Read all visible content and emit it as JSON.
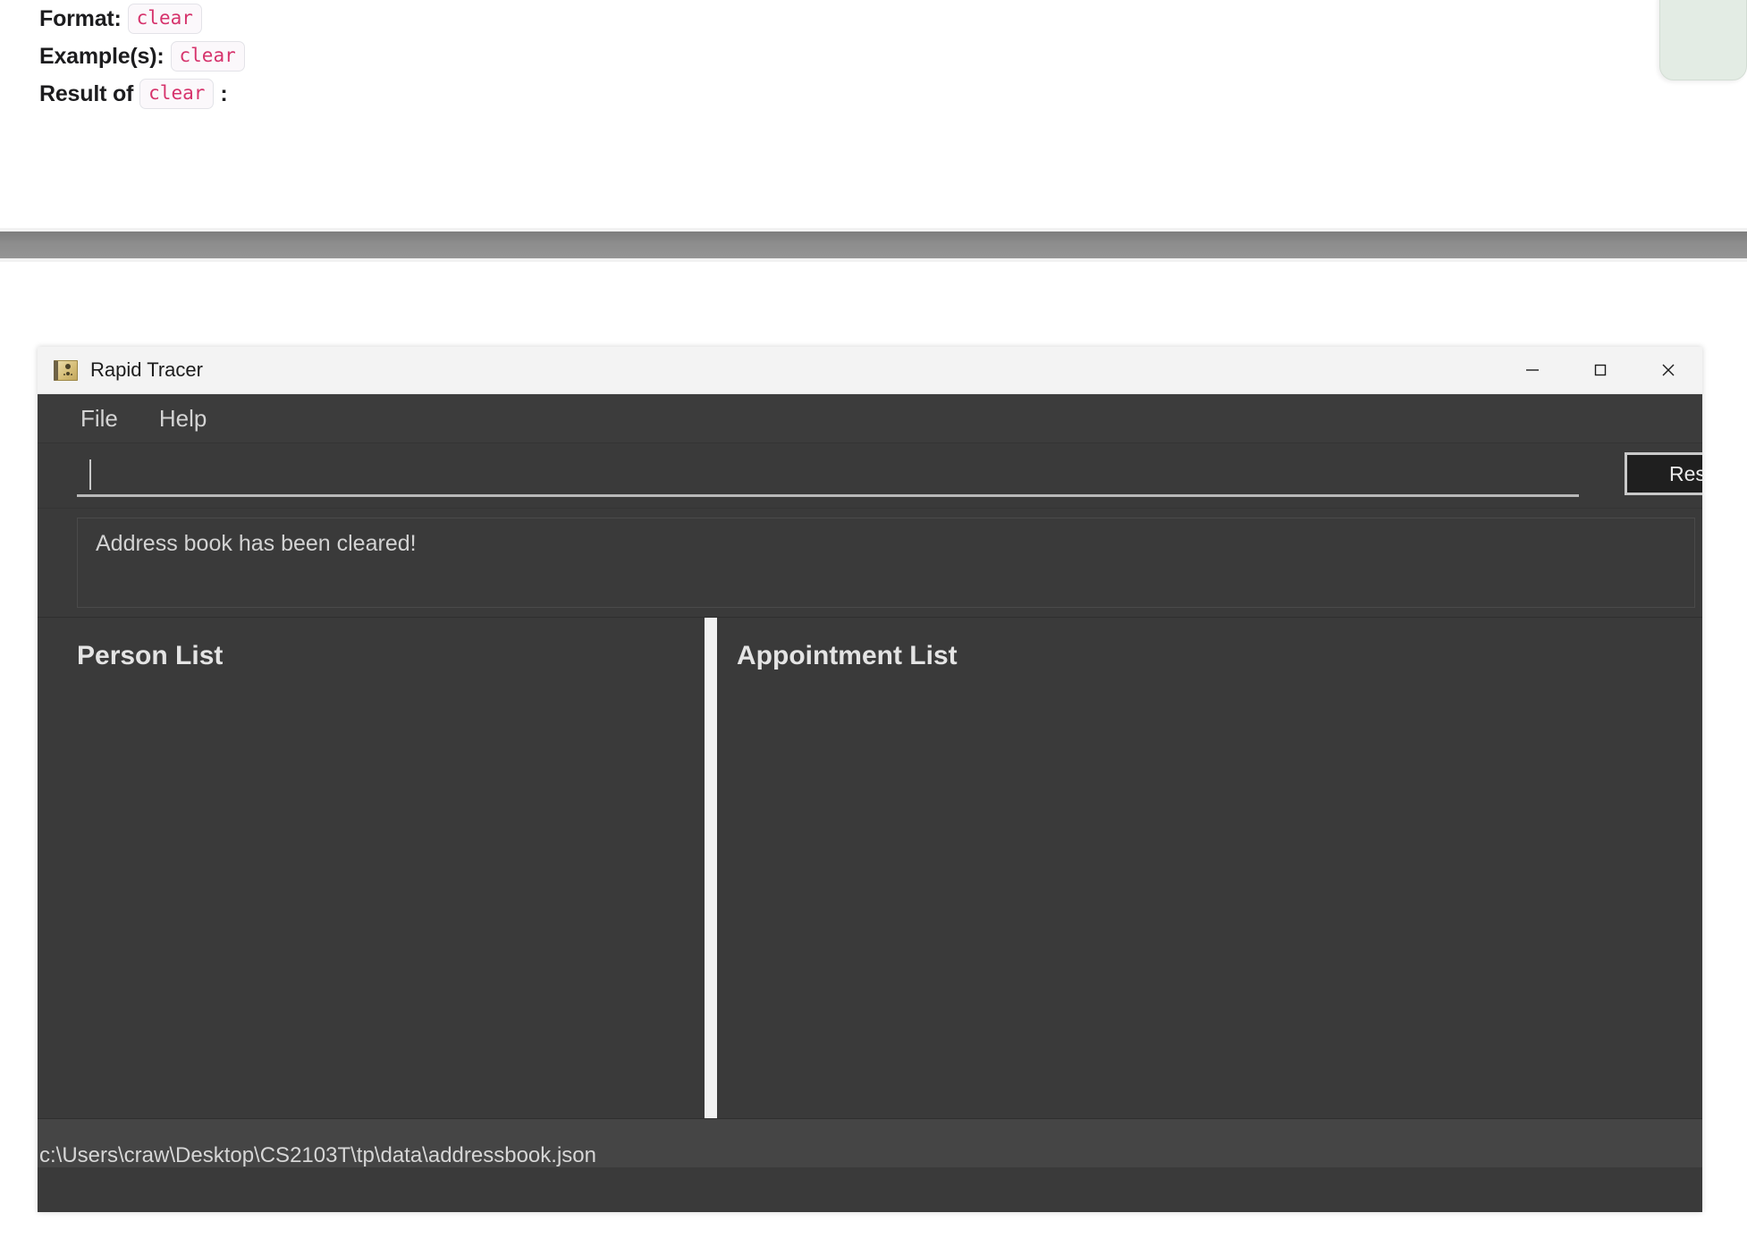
{
  "doc": {
    "lines": [
      {
        "label": "Format:",
        "code": "clear",
        "tail": ""
      },
      {
        "label": "Example(s):",
        "code": "clear",
        "tail": ""
      },
      {
        "label": "Result of",
        "code": "clear",
        "tail": ":"
      }
    ]
  },
  "callout": {
    "name": "mint-panel",
    "color": "#e3ece4"
  },
  "separator": {
    "color_top": "#7d7d7d",
    "color_bottom": "#949494"
  },
  "window": {
    "title": "Rapid Tracer",
    "icon": "address-book-icon",
    "controls": {
      "minimize": "minimize-icon",
      "maximize": "maximize-icon",
      "close": "close-icon"
    },
    "menu": [
      {
        "label": "File"
      },
      {
        "label": "Help"
      }
    ],
    "command": {
      "value": "",
      "placeholder": "",
      "reset_label": "Reset"
    },
    "result": {
      "message": "Address book has been cleared!"
    },
    "panes": {
      "person": {
        "title": "Person List",
        "items": []
      },
      "appointment": {
        "title": "Appointment List",
        "items": []
      }
    },
    "status": {
      "path": "c:\\Users\\craw\\Desktop\\CS2103T\\tp\\data\\addressbook.json"
    }
  }
}
